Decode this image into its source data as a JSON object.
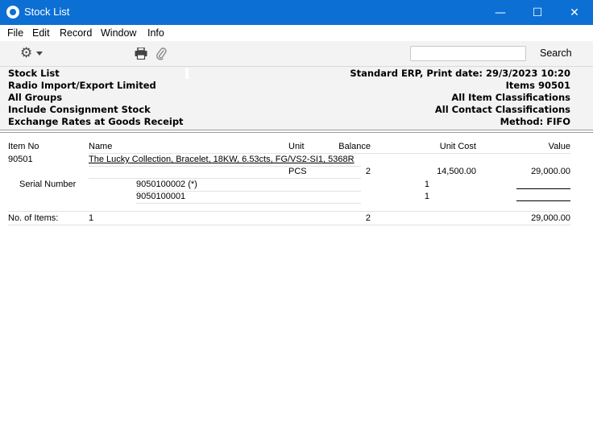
{
  "window": {
    "title": "Stock List",
    "minimize_glyph": "—",
    "maximize_glyph": "☐",
    "close_glyph": "✕"
  },
  "menu": [
    "File",
    "Edit",
    "Record",
    "Window",
    "Info"
  ],
  "toolbar": {
    "gear_glyph": "⚙",
    "search_value": "",
    "search_label": "Search"
  },
  "header": {
    "left": [
      "Stock List",
      "Radio Import/Export Limited",
      "All Groups",
      "Include Consignment Stock",
      "Exchange Rates at Goods Receipt"
    ],
    "right": [
      "Standard ERP, Print date: 29/3/2023 10:20",
      "Items  90501",
      "All Item Classifications",
      "All Contact Classifications",
      "Method: FIFO"
    ]
  },
  "report": {
    "columns": {
      "item_no": "Item No",
      "name": "Name",
      "unit": "Unit",
      "balance": "Balance",
      "unit_cost": "Unit Cost",
      "value": "Value"
    },
    "item": {
      "item_no": "90501",
      "name": "The Lucky Collection, Bracelet, 18KW, 6.53cts, FG/VS2-SI1, 5368R",
      "unit": "PCS",
      "balance": "2",
      "unit_cost": "14,500.00",
      "value": "29,000.00"
    },
    "serial_label": "Serial Number",
    "serials": [
      {
        "number": "9050100002 (*)",
        "qty": "1"
      },
      {
        "number": "9050100001",
        "qty": "1"
      }
    ],
    "totals": {
      "label": "No. of Items:",
      "count": "1",
      "balance": "2",
      "value": "29,000.00"
    }
  },
  "colors": {
    "titlebar": "#0c6fd4",
    "panel": "#f3f3f3"
  },
  "icons": [
    "app-icon",
    "gear-icon",
    "print-icon",
    "attachment-icon"
  ]
}
